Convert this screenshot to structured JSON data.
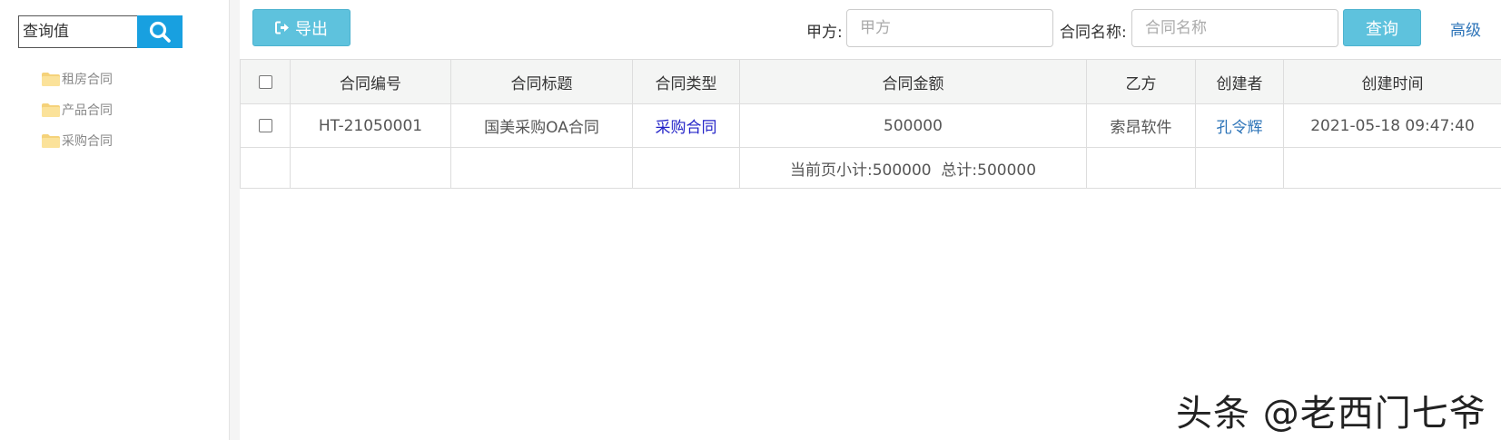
{
  "sidebar": {
    "search_placeholder": "查询值",
    "search_icon": "search-icon",
    "tree_items": [
      {
        "label": "租房合同",
        "icon": "folder-icon"
      },
      {
        "label": "产品合同",
        "icon": "folder-icon"
      },
      {
        "label": "采购合同",
        "icon": "folder-icon"
      }
    ]
  },
  "toolbar": {
    "export_label": "导出",
    "export_icon": "sign-out-icon",
    "party_a_label": "甲方:",
    "party_a_placeholder": "甲方",
    "contract_name_label": "合同名称:",
    "contract_name_placeholder": "合同名称",
    "query_label": "查询",
    "advanced_label": "高级"
  },
  "table": {
    "columns": [
      "合同编号",
      "合同标题",
      "合同类型",
      "合同金额",
      "乙方",
      "创建者",
      "创建时间"
    ],
    "rows": [
      {
        "code": "HT-21050001",
        "title": "国美采购OA合同",
        "type": "采购合同",
        "amount": "500000",
        "party_b": "索昂软件",
        "creator": "孔令辉",
        "created_at": "2021-05-18 09:47:40"
      }
    ],
    "summary": "当前页小计:500000  总计:500000"
  },
  "watermark": "头条 @老西门七爷",
  "colors": {
    "accent": "#5ec2dd",
    "search_button": "#18a0e0",
    "link": "#2d74b8",
    "type_link": "#2323c8",
    "folder": "#f5d27a"
  }
}
